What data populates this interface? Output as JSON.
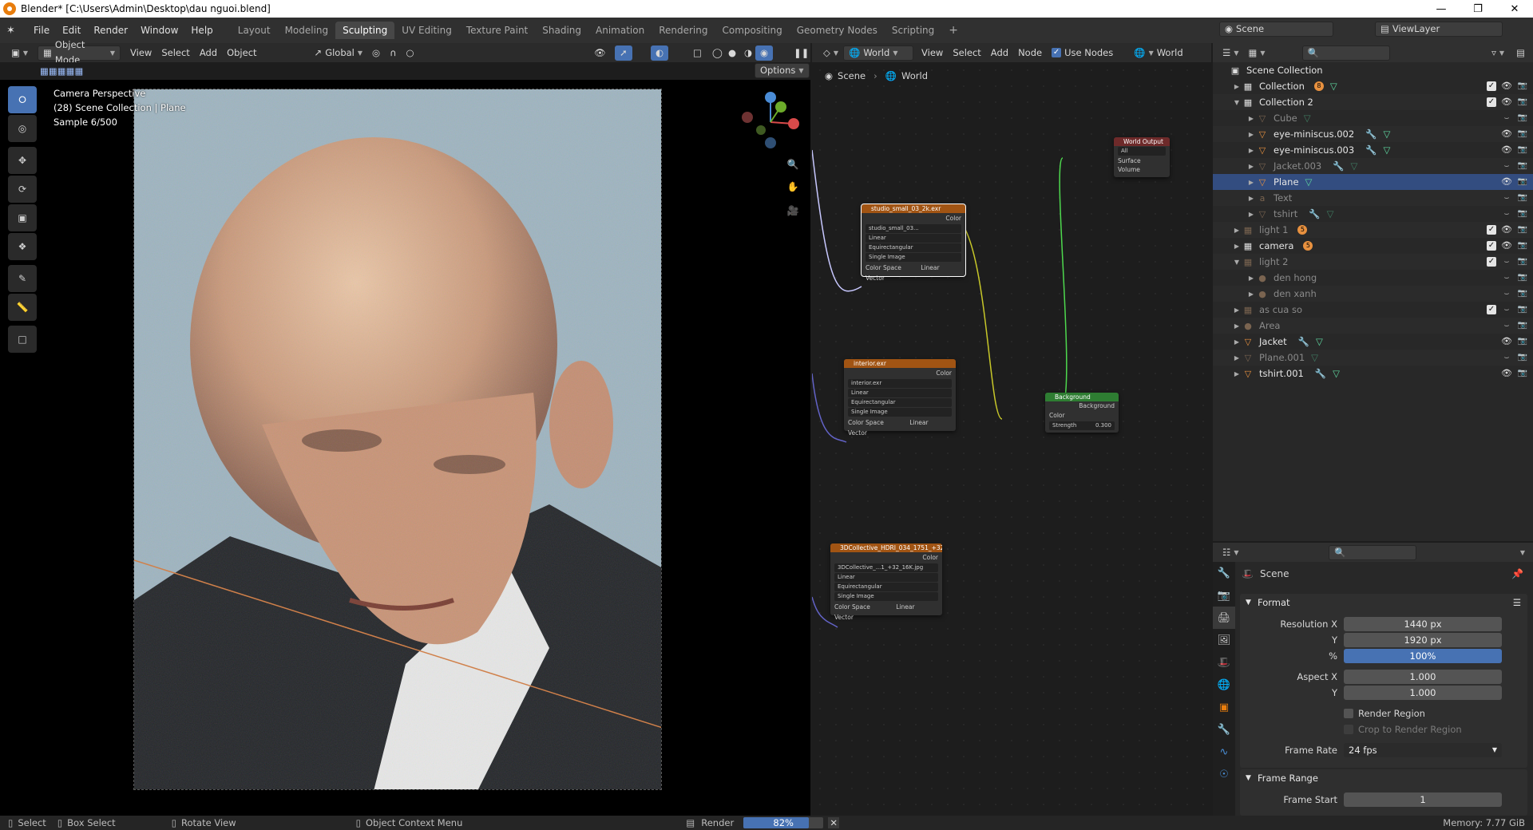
{
  "title": "Blender* [C:\\Users\\Admin\\Desktop\\dau nguoi.blend]",
  "menu": [
    "File",
    "Edit",
    "Render",
    "Window",
    "Help"
  ],
  "workspaces": [
    "Layout",
    "Modeling",
    "Sculpting",
    "UV Editing",
    "Texture Paint",
    "Shading",
    "Animation",
    "Rendering",
    "Compositing",
    "Geometry Nodes",
    "Scripting"
  ],
  "active_workspace": "Sculpting",
  "scene_selector": "Scene",
  "viewlayer_selector": "ViewLayer",
  "viewport": {
    "mode": "Object Mode",
    "menu": [
      "View",
      "Select",
      "Add",
      "Object"
    ],
    "orientation": "Global",
    "options_label": "Options",
    "info_line1": "Camera Perspective",
    "info_line2": "(28) Scene Collection | Plane",
    "info_line3": "Sample 6/500"
  },
  "node_editor": {
    "world_type": "World",
    "menu": [
      "View",
      "Select",
      "Add",
      "Node"
    ],
    "use_nodes_label": "Use Nodes",
    "world_name": "World",
    "breadcrumb_scene": "Scene",
    "breadcrumb_world": "World",
    "nodes": {
      "studio": {
        "title": "studio_small_03_2k.exr",
        "out": "Color",
        "img": "studio_small_03...",
        "interp": "Linear",
        "proj": "Equirectangular",
        "src": "Single Image",
        "cs_label": "Color Space",
        "cs": "Linear",
        "vec": "Vector"
      },
      "interior": {
        "title": "interior.exr",
        "out": "Color",
        "img": "interior.exr",
        "interp": "Linear",
        "proj": "Equirectangular",
        "src": "Single Image",
        "cs_label": "Color Space",
        "cs": "Linear",
        "vec": "Vector"
      },
      "hdr": {
        "title": "3DCollective_HDRI_034_1751_+32_16K.jpg",
        "out": "Color",
        "img": "3DCollective_...1_+32_16K.jpg",
        "interp": "Linear",
        "proj": "Equirectangular",
        "src": "Single Image",
        "cs_label": "Color Space",
        "cs": "Linear",
        "vec": "Vector"
      },
      "output": {
        "title": "World Output",
        "target": "All",
        "surface": "Surface",
        "volume": "Volume"
      },
      "background": {
        "title": "Background",
        "out": "Background",
        "color": "Color",
        "strength_label": "Strength",
        "strength": "0.300"
      }
    }
  },
  "outliner": {
    "root": "Scene Collection",
    "items": [
      {
        "label": "Collection",
        "depth": 1,
        "icon": "collection",
        "open": false,
        "check": true,
        "eye": true,
        "dim": false,
        "badge": "8",
        "extra": "mesh-badge"
      },
      {
        "label": "Collection 2",
        "depth": 1,
        "icon": "collection",
        "open": true,
        "check": true,
        "eye": true,
        "dim": false
      },
      {
        "label": "Cube",
        "depth": 2,
        "icon": "mesh",
        "dim": true,
        "extra": "mesh"
      },
      {
        "label": "eye-miniscus.002",
        "depth": 2,
        "icon": "mesh",
        "dim": false,
        "extra": "wrench-mesh",
        "eye": true
      },
      {
        "label": "eye-miniscus.003",
        "depth": 2,
        "icon": "mesh",
        "dim": false,
        "extra": "wrench-mesh",
        "eye": true
      },
      {
        "label": "Jacket.003",
        "depth": 2,
        "icon": "mesh",
        "dim": true,
        "extra": "wrench-mesh"
      },
      {
        "label": "Plane",
        "depth": 2,
        "icon": "mesh",
        "dim": false,
        "selected": true,
        "extra": "mesh",
        "eye": true
      },
      {
        "label": "Text",
        "depth": 2,
        "icon": "text",
        "dim": true,
        "extra": "text"
      },
      {
        "label": "tshirt",
        "depth": 2,
        "icon": "mesh",
        "dim": true,
        "extra": "wrench-mesh"
      },
      {
        "label": "light 1",
        "depth": 1,
        "icon": "collection",
        "dim": true,
        "check": true,
        "eye": true,
        "badge": "5",
        "extra": "light-badge"
      },
      {
        "label": "camera",
        "depth": 1,
        "icon": "collection",
        "dim": false,
        "check": true,
        "eye": true,
        "badge": "5",
        "extra": "camera-badge"
      },
      {
        "label": "light 2",
        "depth": 1,
        "icon": "collection",
        "open": true,
        "dim": true,
        "check": true
      },
      {
        "label": "den hong",
        "depth": 2,
        "icon": "light",
        "dim": true,
        "extra": "light-data"
      },
      {
        "label": "den xanh",
        "depth": 2,
        "icon": "light",
        "dim": true,
        "extra": "light-data"
      },
      {
        "label": "as cua so",
        "depth": 1,
        "icon": "collection",
        "dim": true,
        "check": true
      },
      {
        "label": "Area",
        "depth": 1,
        "icon": "light",
        "dim": true
      },
      {
        "label": "Jacket",
        "depth": 1,
        "icon": "mesh",
        "dim": false,
        "extra": "wrench-mesh",
        "eye": true
      },
      {
        "label": "Plane.001",
        "depth": 1,
        "icon": "mesh",
        "dim": true,
        "extra": "mesh"
      },
      {
        "label": "tshirt.001",
        "depth": 1,
        "icon": "mesh",
        "dim": false,
        "extra": "wrench-mesh",
        "eye": true
      }
    ]
  },
  "properties": {
    "context": "Scene",
    "format_title": "Format",
    "res_x_label": "Resolution X",
    "res_x": "1440 px",
    "res_y_label": "Y",
    "res_y": "1920 px",
    "pct_label": "%",
    "pct": "100%",
    "aspect_x_label": "Aspect X",
    "aspect_x": "1.000",
    "aspect_y_label": "Y",
    "aspect_y": "1.000",
    "render_region": "Render Region",
    "crop_region": "Crop to Render Region",
    "frame_rate_label": "Frame Rate",
    "frame_rate": "24 fps",
    "frame_range_title": "Frame Range",
    "frame_start_label": "Frame Start",
    "frame_start": "1"
  },
  "status": {
    "select": "Select",
    "box_select": "Box Select",
    "rotate": "Rotate View",
    "context_menu": "Object Context Menu",
    "render_label": "Render",
    "render_progress": "82%",
    "render_progress_value": 0.82,
    "memory": "Memory: 7.77 GiB"
  },
  "colors": {
    "accent": "#4772b3",
    "orange": "#e87d0d",
    "node_green": "#2e7d32"
  }
}
